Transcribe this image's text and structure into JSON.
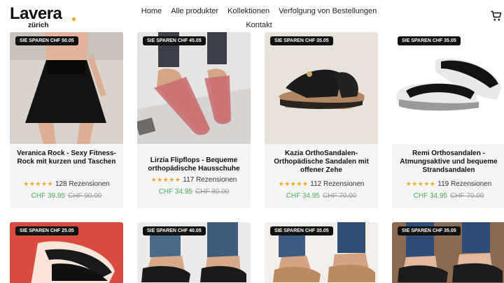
{
  "brand": {
    "name": "Lavera",
    "city": "zürich"
  },
  "nav": [
    "Home",
    "Alle produkter",
    "Kollektionen",
    "Verfolgung von Bestellungen",
    "Kontakt"
  ],
  "products": [
    {
      "badge": "SIE SPAREN CHF 50.05",
      "title": "Veranica Rock - Sexy Fitness-Rock mit kurzen und Taschen",
      "stars": "★★★★★",
      "reviews": "128 Rezensionen",
      "price": "CHF 39.95",
      "compare": "CHF 90.00"
    },
    {
      "badge": "SIE SPAREN CHF 45.05",
      "title": "Lirzia Flipflops - Bequeme orthopädische Hausschuhe",
      "stars": "★★★★★",
      "reviews": "117 Rezensionen",
      "price": "CHF 34.95",
      "compare": "CHF 80.00"
    },
    {
      "badge": "SIE SPAREN CHF 35.05",
      "title": "Kazia OrthoSandalen-Orthopädische Sandalen mit offener Zehe",
      "stars": "★★★★★",
      "reviews": "112 Rezensionen",
      "price": "CHF 34.95",
      "compare": "CHF 70.00"
    },
    {
      "badge": "SIE SPAREN CHF 35.05",
      "title": "Remi Orthosandalen - Atmungsaktive und bequeme Strandsandalen",
      "stars": "★★★★★",
      "reviews": "119 Rezensionen",
      "price": "CHF 34.95",
      "compare": "CHF 70.00"
    }
  ],
  "products_row2": [
    {
      "badge": "SIE SPAREN CHF 25.05"
    },
    {
      "badge": "SIE SPAREN CHF 40.05"
    },
    {
      "badge": "SIE SPAREN CHF 35.05"
    },
    {
      "badge": "SIE SPAREN CHF 35.05"
    }
  ]
}
